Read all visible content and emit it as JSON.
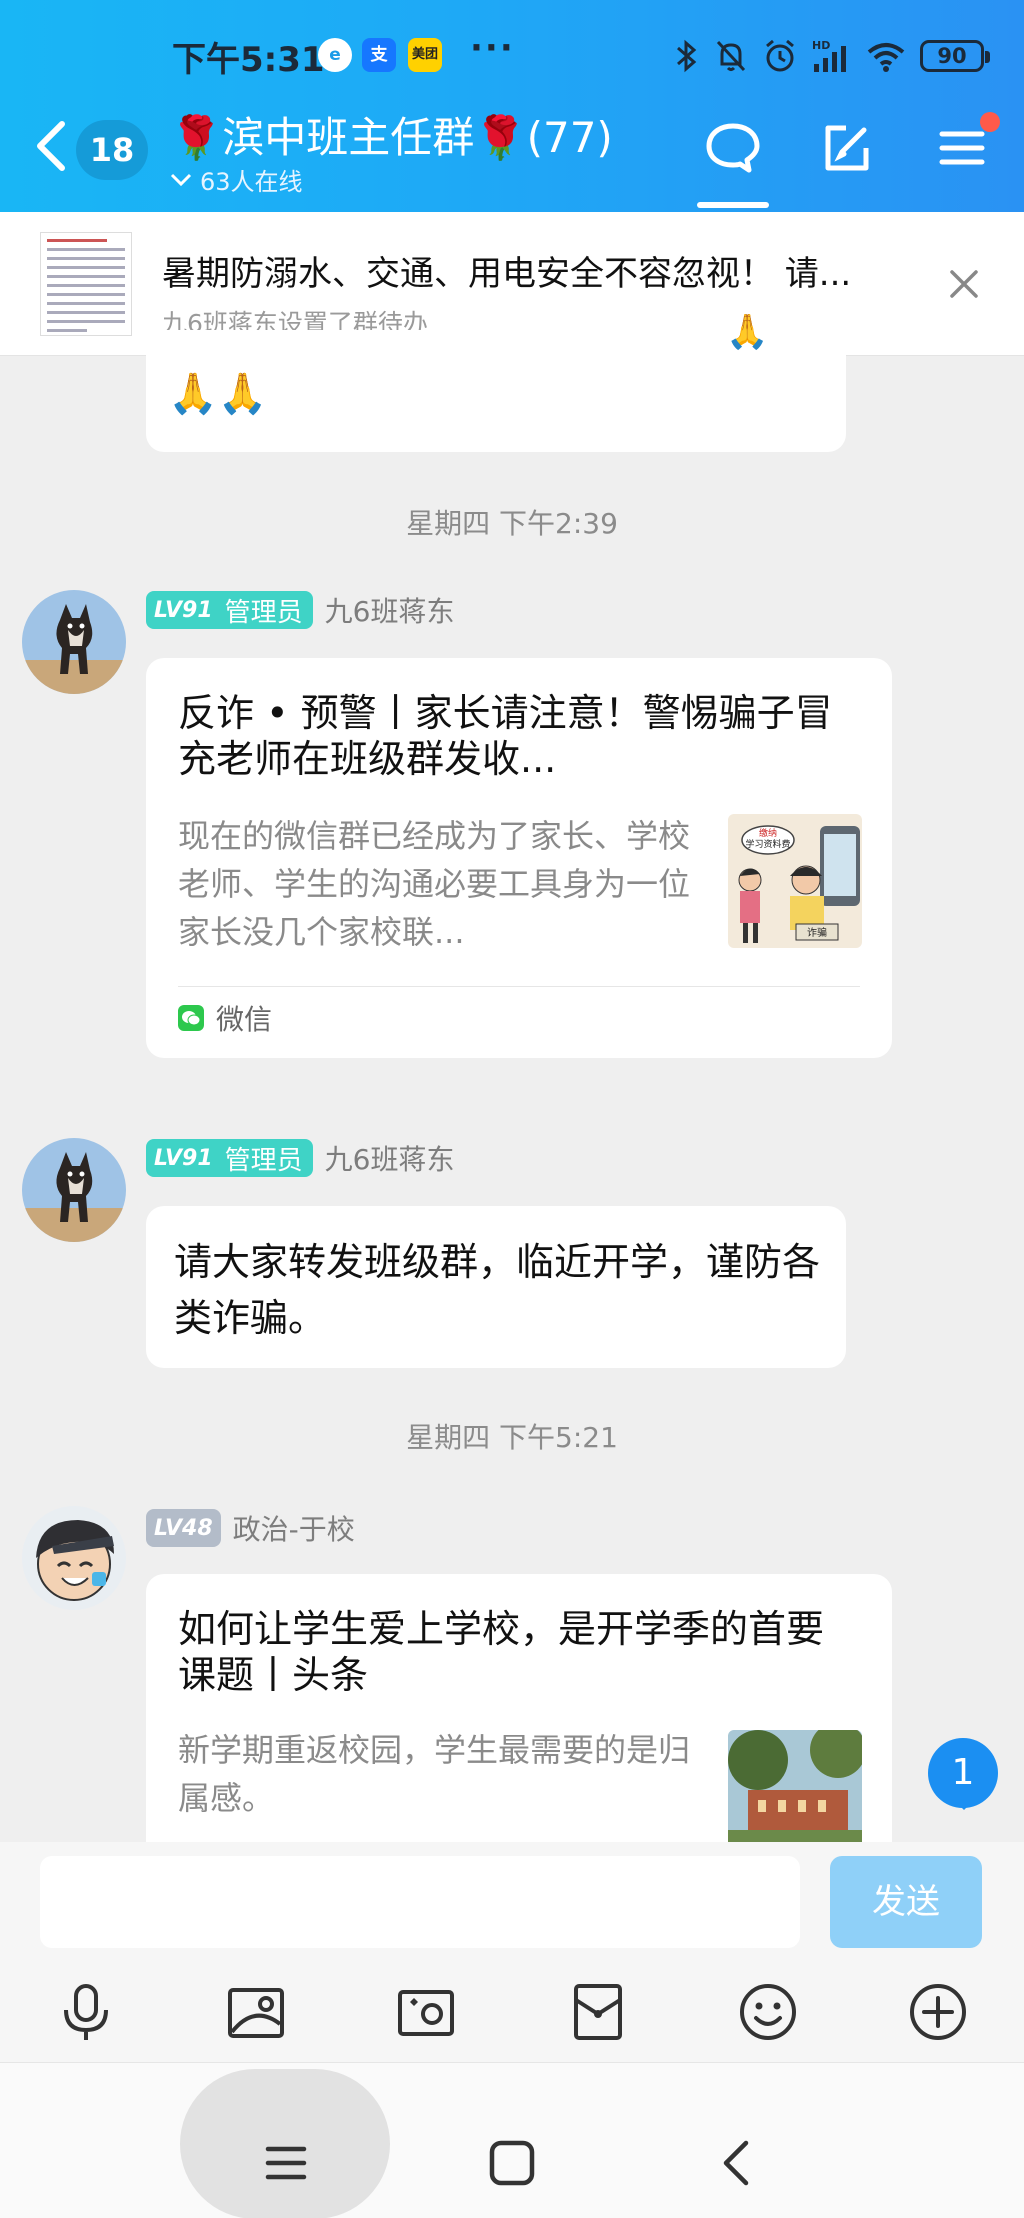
{
  "status_bar": {
    "time": "下午5:31",
    "app_icons": [
      "e",
      "支",
      "美团"
    ],
    "more": "···",
    "battery": "90"
  },
  "header": {
    "unread_count": "18",
    "group_title": "🌹滨中班主任群🌹(77)",
    "online_text": "63人在线",
    "accent_color": "#1ea9f6"
  },
  "pinned": {
    "title": "暑期防溺水、交通、用电安全不容忽视！ 请...",
    "subtitle": "九6班蒋东设置了群待办"
  },
  "messages": {
    "prev_bubble": {
      "emoji": "🙏🙏"
    },
    "time1": "星期四 下午2:39",
    "msg1": {
      "level": "LV91",
      "role": "管理员",
      "sender": "九6班蒋东",
      "card_title": "反诈 • 预警丨家长请注意！警惕骗子冒充老师在班级群发收...",
      "card_desc": "现在的微信群已经成为了家长、学校老师、学生的沟通必要工具身为一位家长没几个家校联...",
      "source": "微信",
      "image_text": [
        "缴纳",
        "学习资料费",
        "诈骗"
      ]
    },
    "msg2": {
      "level": "LV91",
      "role": "管理员",
      "sender": "九6班蒋东",
      "text": "请大家转发班级群，临近开学，谨防各类诈骗。"
    },
    "time2": "星期四 下午5:21",
    "msg3": {
      "level": "LV48",
      "sender": "政治-于校",
      "card_title": "如何让学生爱上学校，是开学季的首要课题丨头条",
      "card_desc": "新学期重返校园，学生最需要的是归属感。"
    }
  },
  "floating_badge": "1",
  "input": {
    "placeholder": "",
    "send_label": "发送"
  }
}
